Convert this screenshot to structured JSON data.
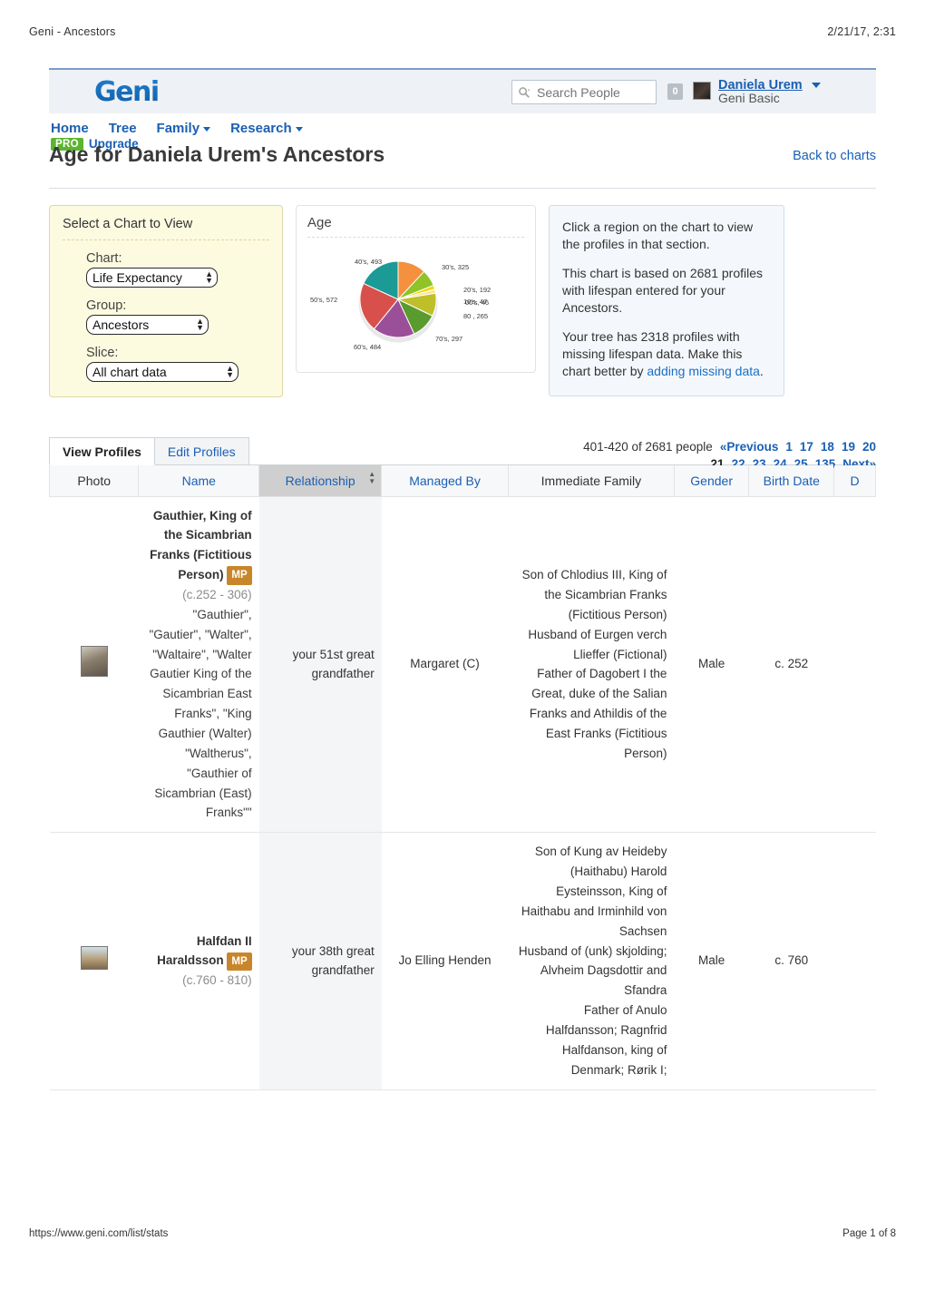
{
  "print": {
    "doc_title": "Geni - Ancestors",
    "timestamp": "2/21/17, 2:31",
    "url": "https://www.geni.com/list/stats",
    "page_label": "Page 1 of 8"
  },
  "header": {
    "logo_text": "Geni",
    "search_placeholder": "Search People",
    "search_value": "",
    "message_count": "0",
    "user_name": "Daniela Urem",
    "user_tier": "Geni Basic"
  },
  "nav": {
    "items": [
      {
        "label": "Home",
        "caret": false
      },
      {
        "label": "Tree",
        "caret": false
      },
      {
        "label": "Family",
        "caret": true
      },
      {
        "label": "Research",
        "caret": true
      }
    ],
    "pro_badge": "PRO",
    "upgrade_label": "Upgrade"
  },
  "title": {
    "heading": "Age for Daniela Urem's Ancestors",
    "back_link": "Back to charts"
  },
  "select_panel": {
    "title": "Select a Chart to View",
    "chart_label": "Chart:",
    "chart_value": "Life Expectancy",
    "group_label": "Group:",
    "group_value": "Ancestors",
    "slice_label": "Slice:",
    "slice_value": "All chart data"
  },
  "info_panel": {
    "line1": "Click a region on the chart to view the profiles in that section.",
    "line2": "This chart is based on 2681 profiles with lifespan entered for your Ancestors.",
    "line3_pre": "Your tree has 2318 profiles with missing lifespan data. Make this chart better by ",
    "line3_link": "adding missing data",
    "line3_post": "."
  },
  "chart_data": {
    "type": "pie",
    "title": "Age",
    "categories": [
      "30's",
      "20's",
      "10's",
      "00's",
      "80 ",
      "70's",
      "60's",
      "50's",
      "40's"
    ],
    "values": [
      325,
      192,
      47,
      46,
      265,
      297,
      484,
      572,
      493
    ],
    "labels": [
      "30's, 325",
      "20's, 192",
      "10's, 47",
      "00's, 46",
      "80 , 265",
      "70's, 297",
      "60's, 484",
      "50's, 572",
      "40's, 493"
    ],
    "colors": [
      "#f4903e",
      "#8fc326",
      "#f2d600",
      "#f7e98e",
      "#bfbf2a",
      "#5a9b2f",
      "#9b4f99",
      "#d8504b",
      "#1c9a95"
    ],
    "legend": "none",
    "grid": false
  },
  "tabs": [
    {
      "label": "View Profiles",
      "active": true
    },
    {
      "label": "Edit Profiles",
      "active": false
    }
  ],
  "pagination": {
    "count_text": "401-420 of 2681 people",
    "previous": "«Previous",
    "pages": [
      "1",
      "17",
      "18",
      "19",
      "20",
      "21",
      "22",
      "23",
      "24",
      "25",
      "135"
    ],
    "current": "21",
    "next": "Next»"
  },
  "table": {
    "columns": [
      {
        "label": "Photo",
        "link": false,
        "sorted": false
      },
      {
        "label": "Name",
        "link": true,
        "sorted": false
      },
      {
        "label": "Relationship",
        "link": true,
        "sorted": true
      },
      {
        "label": "Managed By",
        "link": true,
        "sorted": false
      },
      {
        "label": "Immediate Family",
        "link": false,
        "sorted": false
      },
      {
        "label": "Gender",
        "link": true,
        "sorted": false
      },
      {
        "label": "Birth Date",
        "link": true,
        "sorted": false
      },
      {
        "label": "D",
        "link": true,
        "sorted": false
      }
    ],
    "rows": [
      {
        "photo": "portrait-thumbnail",
        "name": "Gauthier, King of the Sicambrian Franks (Fictitious Person)",
        "mp_badge": "MP",
        "lifespan": "(c.252 - 306)",
        "aka": "\"Gauthier\", \"Gautier\", \"Walter\", \"Waltaire\", \"Walter Gautier King of the Sicambrian East Franks\", \"King Gauthier (Walter) \"Waltherus\", \"Gauthier of Sicambrian (East) Franks\"\"",
        "relationship": "your 51st great grandfather",
        "managed_by": "Margaret (C)",
        "immediate_family": "Son of Chlodius III, King of the Sicambrian Franks (Fictitious Person)\nHusband of Eurgen verch Llieffer (Fictional)\nFather of Dagobert I the Great, duke of the Salian Franks and Athildis of the East Franks (Fictitious Person)",
        "gender": "Male",
        "birth_date": "c. 252",
        "death_date": ""
      },
      {
        "photo": "ship-thumbnail",
        "name": "Halfdan II Haraldsson",
        "mp_badge": "MP",
        "lifespan": "(c.760 - 810)",
        "aka": "",
        "relationship": "your 38th great grandfather",
        "managed_by": "Jo Elling Henden",
        "immediate_family": "Son of Kung av Heideby (Haithabu) Harold Eysteinsson, King of Haithabu and Irminhild von Sachsen\nHusband of (unk) skjolding; Alvheim Dagsdottir and Sfandra\nFather of Anulo Halfdansson; Ragnfrid Halfdanson, king of Denmark; Rørik I;",
        "gender": "Male",
        "birth_date": "c. 760",
        "death_date": ""
      }
    ]
  }
}
